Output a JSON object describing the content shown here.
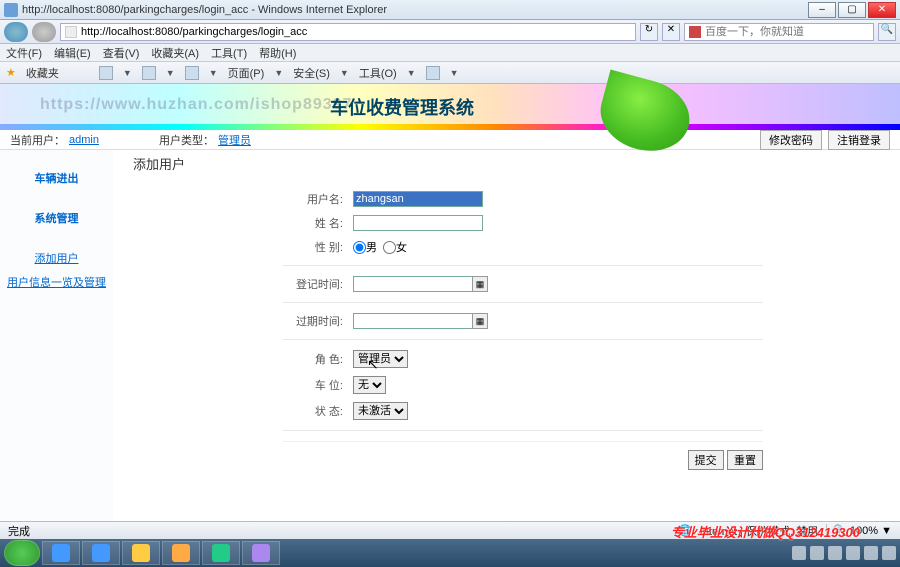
{
  "window": {
    "title": "http://localhost:8080/parkingcharges/login_acc - Windows Internet Explorer"
  },
  "address": {
    "url": "http://localhost:8080/parkingcharges/login_acc",
    "go": "→",
    "refresh": "↻"
  },
  "search": {
    "placeholder": "百度一下，你就知道"
  },
  "menubar": [
    "文件(F)",
    "编辑(E)",
    "查看(V)",
    "收藏夹(A)",
    "工具(T)",
    "帮助(H)"
  ],
  "toolbar2": {
    "fav": "收藏夹",
    "page": "页面(P)",
    "safety": "安全(S)",
    "tools": "工具(O)"
  },
  "banner": {
    "title": "车位收费管理系统",
    "watermark": "https://www.huzhan.com/ishop89397"
  },
  "infobar": {
    "cur_user_label": "当前用户：",
    "cur_user": "admin",
    "user_type_label": "用户类型：",
    "user_type": "管理员",
    "btn_pwd": "修改密码",
    "btn_logout": "注销登录"
  },
  "sidebar": {
    "veh": "车辆进出",
    "sys": "系统管理",
    "add_user": "添加用户",
    "user_mgmt": "用户信息一览及管理"
  },
  "form": {
    "title": "添加用户",
    "username_label": "用户名:",
    "username_value": "zhangsan",
    "name_label": "姓 名:",
    "gender_label": "性 别:",
    "gender_m": "男",
    "gender_f": "女",
    "reg_label": "登记时间:",
    "exp_label": "过期时间:",
    "role_label": "角 色:",
    "role_value": "管理员",
    "slot_label": "车 位:",
    "slot_value": "无",
    "status_label": "状 态:",
    "status_value": "未激活",
    "submit": "提交",
    "reset": "重置"
  },
  "statusbar": {
    "done": "完成",
    "zone": "Internet | 保护模式: 禁用",
    "zoom": "100%"
  },
  "overlay": {
    "ad": "专业毕业设计代做QQ312419300"
  }
}
